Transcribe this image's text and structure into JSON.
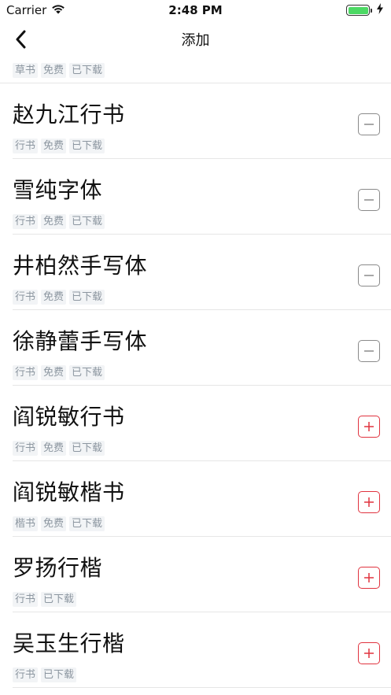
{
  "status": {
    "carrier": "Carrier",
    "time": "2:48 PM"
  },
  "nav": {
    "title": "添加"
  },
  "top_tags": [
    "草书",
    "免费",
    "已下载"
  ],
  "fonts": [
    {
      "name": "赵九江行书",
      "tags": [
        "行书",
        "免费",
        "已下载"
      ],
      "action": "remove"
    },
    {
      "name": "雪纯字体",
      "tags": [
        "行书",
        "免费",
        "已下载"
      ],
      "action": "remove"
    },
    {
      "name": "井柏然手写体",
      "tags": [
        "行书",
        "免费",
        "已下载"
      ],
      "action": "remove"
    },
    {
      "name": "徐静蕾手写体",
      "tags": [
        "行书",
        "免费",
        "已下载"
      ],
      "action": "remove"
    },
    {
      "name": "阎锐敏行书",
      "tags": [
        "行书",
        "免费",
        "已下载"
      ],
      "action": "add"
    },
    {
      "name": "阎锐敏楷书",
      "tags": [
        "楷书",
        "免费",
        "已下载"
      ],
      "action": "add"
    },
    {
      "name": "罗扬行楷",
      "tags": [
        "行书",
        "已下载"
      ],
      "action": "add"
    },
    {
      "name": "吴玉生行楷",
      "tags": [
        "行书",
        "已下载"
      ],
      "action": "add"
    }
  ],
  "colors": {
    "add": "#e0333f",
    "remove": "#8a8a8a",
    "battery": "#4cd964"
  }
}
